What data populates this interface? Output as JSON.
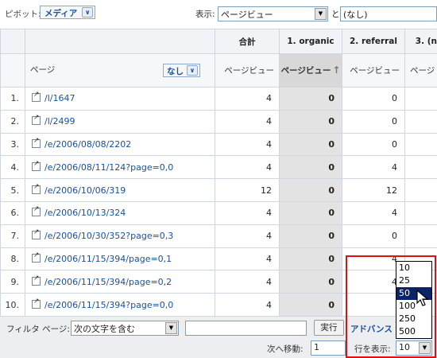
{
  "topbar": {
    "pivot_label": "ピボット:",
    "pivot_value": "メディア",
    "show_label": "表示:",
    "metric_value": "ページビュー",
    "and_label": "と",
    "second_metric_value": "(なし)"
  },
  "table": {
    "headers": {
      "total": "合計",
      "organic": "1. organic",
      "referral": "2. referral",
      "third": "3. (no"
    },
    "subheaders": {
      "page": "ページ",
      "secondary_dim": "なし",
      "total": "ページビュー",
      "organic": "ページビュー",
      "referral": "ページビュー",
      "third": "ページ"
    },
    "rows": [
      {
        "idx": "1.",
        "page": "/l/1647",
        "total": "4",
        "organic": "0",
        "referral": "0"
      },
      {
        "idx": "2.",
        "page": "/l/2499",
        "total": "4",
        "organic": "0",
        "referral": "0"
      },
      {
        "idx": "3.",
        "page": "/e/2006/08/08/2202",
        "total": "4",
        "organic": "0",
        "referral": "0"
      },
      {
        "idx": "4.",
        "page": "/e/2006/08/11/124?page=0,0",
        "total": "4",
        "organic": "0",
        "referral": "4"
      },
      {
        "idx": "5.",
        "page": "/e/2006/10/06/319",
        "total": "12",
        "organic": "0",
        "referral": "12"
      },
      {
        "idx": "6.",
        "page": "/e/2006/10/13/324",
        "total": "4",
        "organic": "0",
        "referral": "4"
      },
      {
        "idx": "7.",
        "page": "/e/2006/10/30/352?page=0,3",
        "total": "4",
        "organic": "0",
        "referral": "0"
      },
      {
        "idx": "8.",
        "page": "/e/2006/11/15/394/page=0,1",
        "total": "4",
        "organic": "0",
        "referral": "4"
      },
      {
        "idx": "9.",
        "page": "/e/2006/11/15/394/page=0,2",
        "total": "4",
        "organic": "0",
        "referral": "4"
      },
      {
        "idx": "10.",
        "page": "/e/2006/11/15/394?page=0,0",
        "total": "4",
        "organic": "0",
        "referral": ""
      }
    ]
  },
  "footer": {
    "filter_label": "フィルタ ページ:",
    "filter_mode": "次の文字を含む",
    "filter_value": "",
    "run_label": "実行",
    "advanced_label": "アドバンス",
    "next_label": "次へ移動:",
    "next_value": "1",
    "rows_label": "行を表示:",
    "rows_value": "10"
  },
  "rows_dropdown": {
    "options": [
      "10",
      "25",
      "50",
      "100",
      "250",
      "500"
    ],
    "selected": "50"
  },
  "colors": {
    "link": "#1a4f9c",
    "highlight": "#e01010",
    "selected_option": "#0a246a"
  }
}
